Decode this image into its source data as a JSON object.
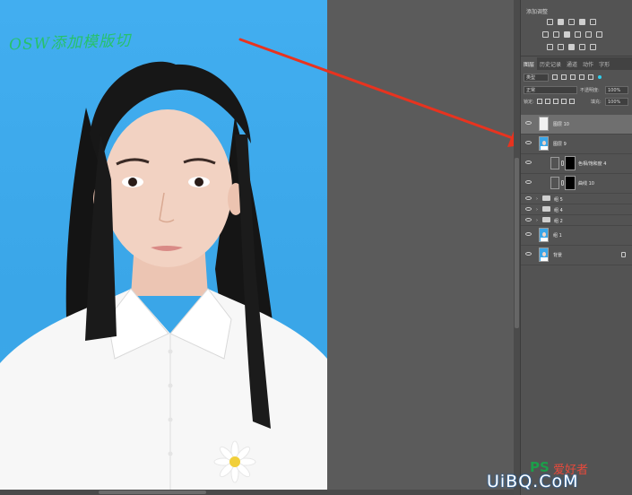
{
  "annotation": {
    "text": "OSW添加模版切"
  },
  "adjustments": {
    "title": "添加调整"
  },
  "layers_panel": {
    "tabs": [
      "图层",
      "历史记录",
      "通道",
      "动作",
      "字形"
    ],
    "active_tab": "图层",
    "filter": {
      "kind": "类型"
    },
    "blend_mode": "正常",
    "opacity_label": "不透明度:",
    "opacity_value": "100%",
    "lock_label": "锁定:",
    "fill_label": "填充:",
    "fill_value": "100%",
    "layers": [
      {
        "name": "图层 10",
        "type": "image-white",
        "selected": true
      },
      {
        "name": "图层 9",
        "type": "image"
      },
      {
        "name": "色相/饱和度 4",
        "type": "adjustment"
      },
      {
        "name": "曲线 10",
        "type": "adjustment"
      },
      {
        "name": "组 5",
        "type": "group"
      },
      {
        "name": "组 4",
        "type": "group"
      },
      {
        "name": "组 2",
        "type": "group"
      },
      {
        "name": "组 1",
        "type": "image-small"
      },
      {
        "name": "背景",
        "type": "image",
        "locked": true
      }
    ]
  },
  "watermark": {
    "ps": "PS",
    "cn": "爱好者",
    "url": "UiBQ.CoM"
  },
  "colors": {
    "photo_bg": "#3eaaea",
    "annotation": "#27c26b",
    "arrow": "#e8331f",
    "panel_bg": "#535353",
    "canvas_bg": "#5b5b5b"
  }
}
